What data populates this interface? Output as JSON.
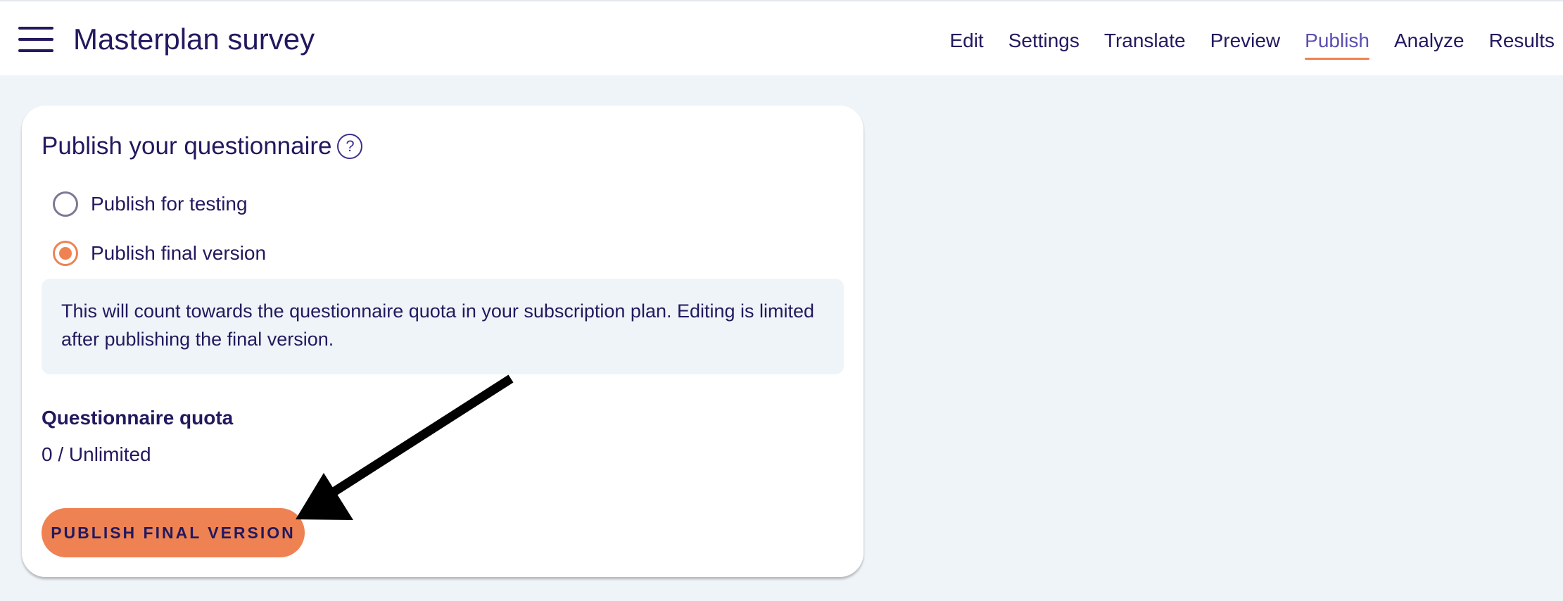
{
  "header": {
    "title": "Masterplan survey",
    "menu_icon": "hamburger-menu-icon",
    "tabs": [
      {
        "label": "Edit",
        "active": false
      },
      {
        "label": "Settings",
        "active": false
      },
      {
        "label": "Translate",
        "active": false
      },
      {
        "label": "Preview",
        "active": false
      },
      {
        "label": "Publish",
        "active": true
      },
      {
        "label": "Analyze",
        "active": false
      },
      {
        "label": "Results",
        "active": false
      }
    ]
  },
  "card": {
    "title": "Publish your questionnaire",
    "help_icon": "help-circle-icon",
    "help_glyph": "?",
    "options": [
      {
        "label": "Publish for testing",
        "selected": false
      },
      {
        "label": "Publish final version",
        "selected": true
      }
    ],
    "info_text": "This will count towards the questionnaire quota in your subscription plan. Editing is limited after publishing the final version.",
    "quota_label": "Questionnaire quota",
    "quota_value": "0 / Unlimited",
    "publish_button_label": "PUBLISH FINAL VERSION"
  },
  "colors": {
    "text": "#22195e",
    "accent": "#ef8252",
    "active_tab": "#5b4fb0",
    "page_background": "#eff4f8"
  }
}
